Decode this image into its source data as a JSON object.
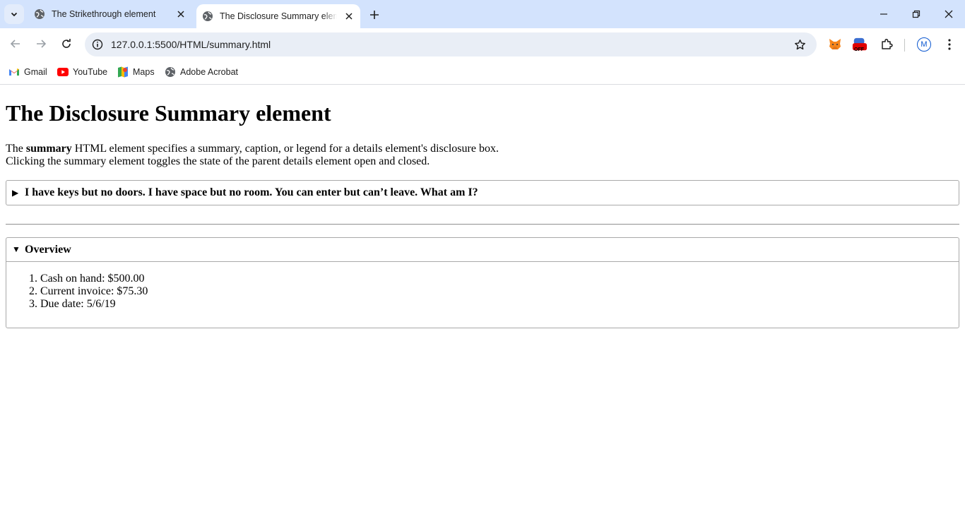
{
  "tabs": [
    {
      "title": "The Strikethrough element"
    },
    {
      "title": "The Disclosure Summary element"
    }
  ],
  "address_bar": {
    "url": "127.0.0.1:5500/HTML/summary.html"
  },
  "extensions": {
    "off_badge": "OFF",
    "profile_initial": "M"
  },
  "bookmarks": [
    {
      "label": "Gmail",
      "icon": "gmail-icon"
    },
    {
      "label": "YouTube",
      "icon": "youtube-icon"
    },
    {
      "label": "Maps",
      "icon": "maps-icon"
    },
    {
      "label": "Adobe Acrobat",
      "icon": "globe-icon"
    }
  ],
  "page": {
    "heading": "The Disclosure Summary element",
    "intro_prefix": "The ",
    "intro_bold": "summary",
    "intro_line1_rest": " HTML element specifies a summary, caption, or legend for a details element's disclosure box.",
    "intro_line2": "Clicking the summary element toggles the state of the parent details element open and closed.",
    "details1": {
      "marker": "▶",
      "summary": "I have keys but no doors. I have space but no room. You can enter but can’t leave. What am I?"
    },
    "details2": {
      "marker": "▼",
      "summary": "Overview",
      "items": [
        "Cash on hand: $500.00",
        "Current invoice: $75.30",
        "Due date: 5/6/19"
      ]
    }
  },
  "colors": {
    "tabstrip": "#d3e3fd",
    "omnibox": "#e9eef6",
    "accent": "#0b57d0",
    "off_badge": "#e00000"
  }
}
